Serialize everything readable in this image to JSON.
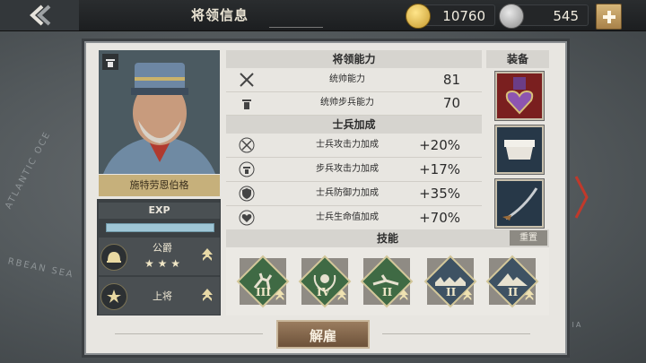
{
  "header": {
    "title": "将领信息",
    "gold": "10760",
    "silver": "545"
  },
  "map": {
    "labels": [
      "ATLANTIC OCE",
      "RBEAN SEA",
      "BIA"
    ]
  },
  "general": {
    "name": "施特劳恩伯格",
    "exp_label": "EXP",
    "exp_fraction": 1.0,
    "ranks": [
      {
        "label": "公爵",
        "stars": "★ ★ ★"
      },
      {
        "label": "上将"
      }
    ]
  },
  "abilities": {
    "header": "将领能力",
    "rows": [
      {
        "label": "统帅能力",
        "value": "81",
        "icon": "crossed-swords-icon"
      },
      {
        "label": "统帅步兵能力",
        "value": "70",
        "icon": "infantry-icon"
      }
    ]
  },
  "bonuses": {
    "header": "士兵加成",
    "rows": [
      {
        "label": "士兵攻击力加成",
        "value": "+20%",
        "icon": "attack-icon"
      },
      {
        "label": "步兵攻击力加成",
        "value": "+17%",
        "icon": "infantry-attack-icon"
      },
      {
        "label": "士兵防御力加成",
        "value": "+35%",
        "icon": "shield-icon"
      },
      {
        "label": "士兵生命值加成",
        "value": "+70%",
        "icon": "heart-icon"
      }
    ]
  },
  "equipment": {
    "header": "装备",
    "items": [
      "purple-heart-medal",
      "white-belt",
      "sabre"
    ]
  },
  "skills": {
    "header": "技能",
    "reset": "重置",
    "items": [
      {
        "level": "III",
        "icon": "charging-soldier-icon",
        "color": "#3f6a44"
      },
      {
        "level": "IV",
        "icon": "laurel-soldier-icon",
        "color": "#3f6a44"
      },
      {
        "level": "II",
        "icon": "crawling-soldier-icon",
        "color": "#3f6a44"
      },
      {
        "level": "II",
        "icon": "trench-icon",
        "color": "#3e5263"
      },
      {
        "level": "II",
        "icon": "mountain-icon",
        "color": "#3e5263"
      }
    ]
  },
  "actions": {
    "fire": "解雇"
  }
}
